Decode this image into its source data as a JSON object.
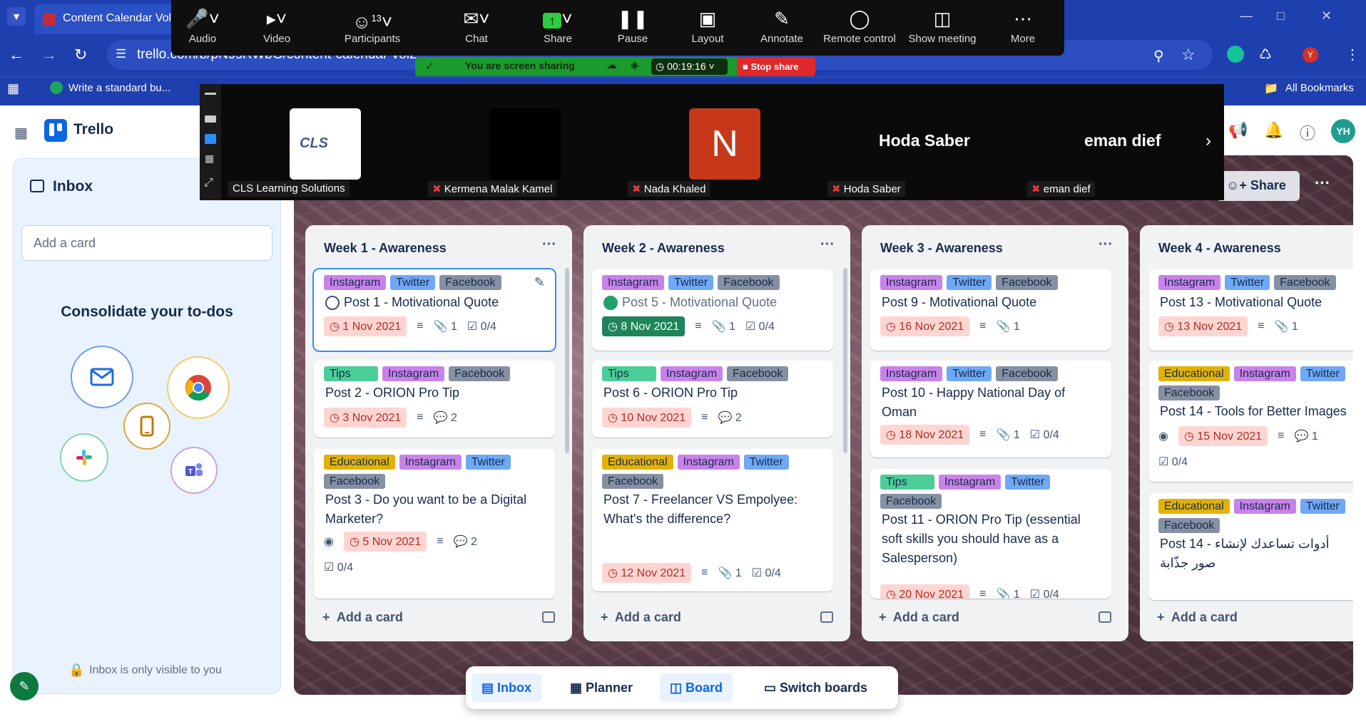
{
  "browser": {
    "tab_title": "Content Calendar Vol.2",
    "url": "trello.com/b/pN9sRWbG/content-calendar-vol2",
    "bookmarks": [
      "Write a standard bu...",
      "All Bookmarks"
    ],
    "profile_initial": "Y"
  },
  "zoom": {
    "toolbar": [
      {
        "label": "Audio",
        "icon": "microphone-icon"
      },
      {
        "label": "Video",
        "icon": "video-camera-icon"
      },
      {
        "label": "Participants",
        "icon": "participants-icon"
      },
      {
        "label": "Chat",
        "icon": "chat-icon"
      },
      {
        "label": "Share",
        "icon": "share-screen-icon"
      },
      {
        "label": "Pause",
        "icon": "pause-icon"
      },
      {
        "label": "Layout",
        "icon": "layout-icon"
      },
      {
        "label": "Annotate",
        "icon": "pen-icon"
      },
      {
        "label": "Remote control",
        "icon": "mouse-icon"
      },
      {
        "label": "Show meeting",
        "icon": "meeting-window-icon"
      },
      {
        "label": "More",
        "icon": "more-icon"
      }
    ],
    "participants_count": "13",
    "sharing_status": "You are screen sharing",
    "timer": "00:19:16",
    "stop_share": "Stop share",
    "participants": [
      {
        "name": "CLS Learning Solutions",
        "tile": "logo",
        "muted": false
      },
      {
        "name": "Kermena Malak Kamel",
        "tile": "black",
        "muted": true
      },
      {
        "name": "Nada Khaled",
        "tile": "initial",
        "initial": "N",
        "muted": true
      },
      {
        "name": "Hoda Saber",
        "tile": "name",
        "muted": true
      },
      {
        "name": "eman dief",
        "tile": "name",
        "muted": true
      }
    ],
    "cls_logo_text": "CLS"
  },
  "trello": {
    "app_name": "Trello",
    "avatar": "YH",
    "share_label": "Share",
    "inbox": {
      "title": "Inbox",
      "add_card_placeholder": "Add a card",
      "consolidate": "Consolidate your to-dos",
      "footer": "Inbox is only visible to you"
    },
    "add_card_label": "Add a card",
    "lists": [
      {
        "title": "Week 1 - Awareness",
        "cards": [
          {
            "labels": [
              "Instagram",
              "Twitter",
              "Facebook"
            ],
            "title": "Post 1 - Motivational Quote",
            "checkbox": true,
            "due": "1 Nov 2021",
            "desc": true,
            "attachments": "1",
            "checklist": "0/4"
          },
          {
            "labels": [
              "Tips",
              "Instagram",
              "Facebook"
            ],
            "title": "Post 2 - ORION Pro Tip",
            "due": "3 Nov 2021",
            "desc": true,
            "comments": "2"
          },
          {
            "labels": [
              "Educational",
              "Instagram",
              "Twitter",
              "Facebook"
            ],
            "title": "Post 3 - Do you want to be a Digital Marketer?",
            "watch": true,
            "due": "5 Nov 2021",
            "desc": true,
            "comments": "2",
            "checklist": "0/4"
          }
        ]
      },
      {
        "title": "Week 2 - Awareness",
        "cards": [
          {
            "labels": [
              "Instagram",
              "Twitter",
              "Facebook"
            ],
            "title": "Post 5 - Motivational Quote",
            "checkbox_done": true,
            "due": "8 Nov 2021",
            "due_done": true,
            "desc": true,
            "attachments": "1",
            "checklist": "0/4"
          },
          {
            "labels": [
              "Tips",
              "Instagram",
              "Facebook"
            ],
            "title": "Post 6 - ORION Pro Tip",
            "due": "10 Nov 2021",
            "desc": true,
            "comments": "2"
          },
          {
            "labels": [
              "Educational",
              "Instagram",
              "Twitter",
              "Facebook"
            ],
            "title": "Post 7 - Freelancer VS Empolyee: What's the difference?",
            "due": "12 Nov 2021",
            "desc": true,
            "attachments": "1",
            "checklist": "0/4"
          }
        ]
      },
      {
        "title": "Week 3 - Awareness",
        "cards": [
          {
            "labels": [
              "Instagram",
              "Twitter",
              "Facebook"
            ],
            "title": "Post 9 - Motivational Quote",
            "due": "16 Nov 2021",
            "desc": true,
            "attachments": "1"
          },
          {
            "labels": [
              "Instagram",
              "Twitter",
              "Facebook"
            ],
            "title": "Post 10 - Happy National Day of Oman",
            "due": "18 Nov 2021",
            "desc": true,
            "attachments": "1",
            "checklist": "0/4"
          },
          {
            "labels": [
              "Tips",
              "Instagram",
              "Twitter",
              "Facebook"
            ],
            "title": "Post 11 - ORION Pro Tip (essential soft skills you should have as a Salesperson)",
            "due": "20 Nov 2021",
            "desc": true,
            "attachments": "1",
            "checklist": "0/4"
          }
        ]
      },
      {
        "title": "Week 4 - Awareness",
        "cards": [
          {
            "labels": [
              "Instagram",
              "Twitter",
              "Facebook"
            ],
            "title": "Post 13 - Motivational Quote",
            "due": "13 Nov 2021",
            "desc": true,
            "attachments": "1"
          },
          {
            "labels": [
              "Educational",
              "Instagram",
              "Twitter",
              "Facebook"
            ],
            "title": "Post 14 - Tools for Better Images",
            "watch": true,
            "due": "15 Nov 2021",
            "desc": true,
            "comments": "1",
            "checklist": "0/4"
          },
          {
            "labels": [
              "Educational",
              "Instagram",
              "Twitter",
              "Facebook"
            ],
            "title": "Post 14 - أدوات تساعدك لإنشاء صور جذّابة"
          }
        ]
      }
    ],
    "switcher": [
      {
        "label": "Inbox",
        "active": true
      },
      {
        "label": "Planner",
        "active": false
      },
      {
        "label": "Board",
        "active": true
      },
      {
        "label": "Switch boards",
        "active": false
      }
    ]
  }
}
